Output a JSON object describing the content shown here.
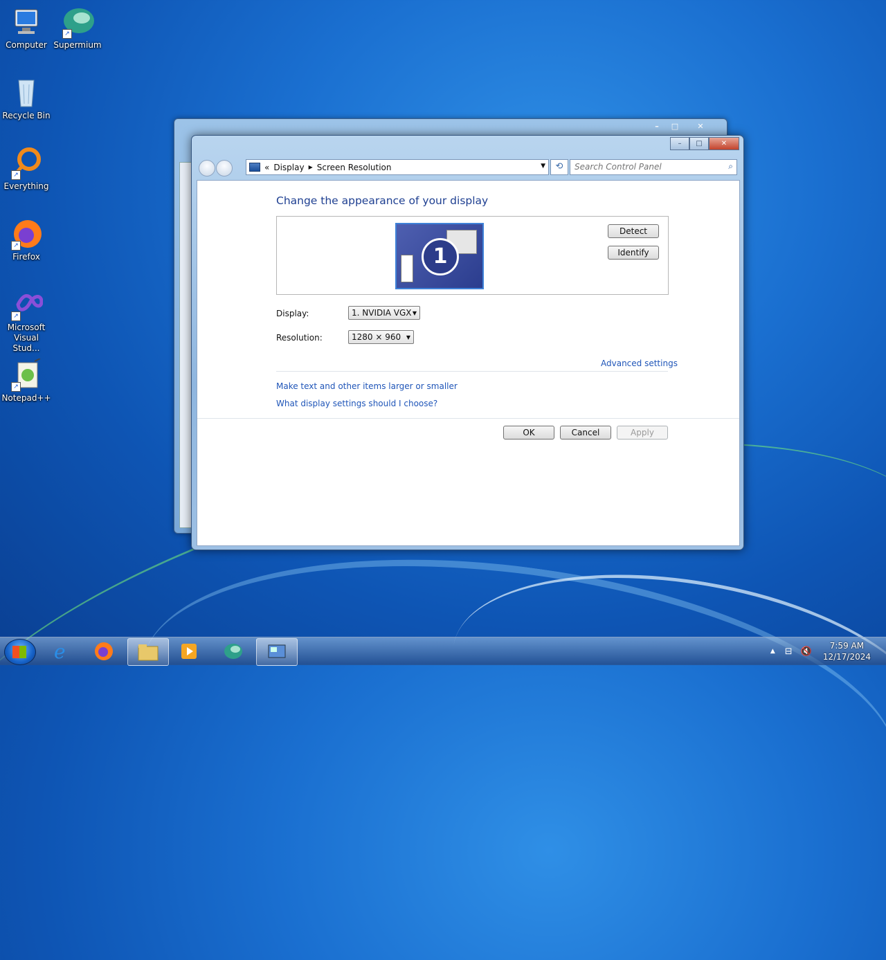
{
  "desktop": {
    "icons": [
      {
        "label": "Computer"
      },
      {
        "label": "Supermium"
      },
      {
        "label": "Recycle Bin"
      },
      {
        "label": "Everything"
      },
      {
        "label": "Firefox"
      },
      {
        "label": "Microsoft Visual Stud..."
      },
      {
        "label": "Notepad++"
      }
    ]
  },
  "window": {
    "address": {
      "root_chevron": "«",
      "crumbs": [
        "Display",
        "Screen Resolution"
      ]
    },
    "search_placeholder": "Search Control Panel",
    "heading": "Change the appearance of your display",
    "monitor_number": "1",
    "detect_label": "Detect",
    "identify_label": "Identify",
    "display_label": "Display:",
    "display_value": "1. NVIDIA VGX",
    "resolution_label": "Resolution:",
    "resolution_value": "1280 × 960",
    "advanced_link": "Advanced settings",
    "link_text_size": "Make text and other items larger or smaller",
    "link_help": "What display settings should I choose?",
    "ok_label": "OK",
    "cancel_label": "Cancel",
    "apply_label": "Apply"
  },
  "taskbar": {
    "clock_time": "7:59 AM",
    "clock_date": "12/17/2024"
  }
}
